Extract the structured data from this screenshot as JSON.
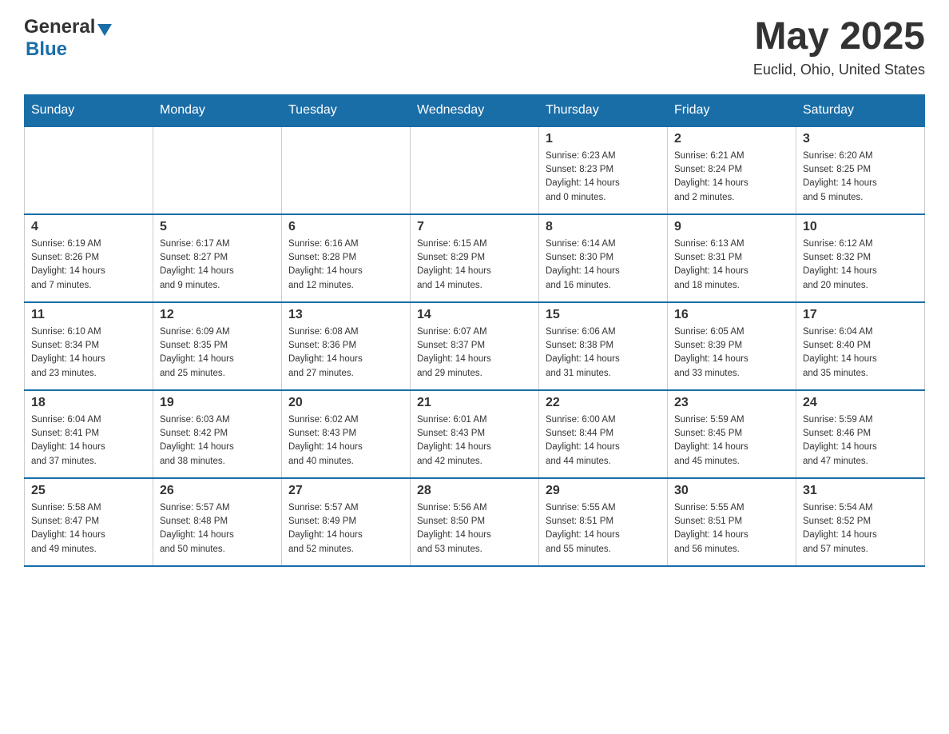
{
  "header": {
    "logo_general": "General",
    "logo_blue": "Blue",
    "title": "May 2025",
    "subtitle": "Euclid, Ohio, United States"
  },
  "weekdays": [
    "Sunday",
    "Monday",
    "Tuesday",
    "Wednesday",
    "Thursday",
    "Friday",
    "Saturday"
  ],
  "weeks": [
    [
      {
        "day": "",
        "info": ""
      },
      {
        "day": "",
        "info": ""
      },
      {
        "day": "",
        "info": ""
      },
      {
        "day": "",
        "info": ""
      },
      {
        "day": "1",
        "info": "Sunrise: 6:23 AM\nSunset: 8:23 PM\nDaylight: 14 hours\nand 0 minutes."
      },
      {
        "day": "2",
        "info": "Sunrise: 6:21 AM\nSunset: 8:24 PM\nDaylight: 14 hours\nand 2 minutes."
      },
      {
        "day": "3",
        "info": "Sunrise: 6:20 AM\nSunset: 8:25 PM\nDaylight: 14 hours\nand 5 minutes."
      }
    ],
    [
      {
        "day": "4",
        "info": "Sunrise: 6:19 AM\nSunset: 8:26 PM\nDaylight: 14 hours\nand 7 minutes."
      },
      {
        "day": "5",
        "info": "Sunrise: 6:17 AM\nSunset: 8:27 PM\nDaylight: 14 hours\nand 9 minutes."
      },
      {
        "day": "6",
        "info": "Sunrise: 6:16 AM\nSunset: 8:28 PM\nDaylight: 14 hours\nand 12 minutes."
      },
      {
        "day": "7",
        "info": "Sunrise: 6:15 AM\nSunset: 8:29 PM\nDaylight: 14 hours\nand 14 minutes."
      },
      {
        "day": "8",
        "info": "Sunrise: 6:14 AM\nSunset: 8:30 PM\nDaylight: 14 hours\nand 16 minutes."
      },
      {
        "day": "9",
        "info": "Sunrise: 6:13 AM\nSunset: 8:31 PM\nDaylight: 14 hours\nand 18 minutes."
      },
      {
        "day": "10",
        "info": "Sunrise: 6:12 AM\nSunset: 8:32 PM\nDaylight: 14 hours\nand 20 minutes."
      }
    ],
    [
      {
        "day": "11",
        "info": "Sunrise: 6:10 AM\nSunset: 8:34 PM\nDaylight: 14 hours\nand 23 minutes."
      },
      {
        "day": "12",
        "info": "Sunrise: 6:09 AM\nSunset: 8:35 PM\nDaylight: 14 hours\nand 25 minutes."
      },
      {
        "day": "13",
        "info": "Sunrise: 6:08 AM\nSunset: 8:36 PM\nDaylight: 14 hours\nand 27 minutes."
      },
      {
        "day": "14",
        "info": "Sunrise: 6:07 AM\nSunset: 8:37 PM\nDaylight: 14 hours\nand 29 minutes."
      },
      {
        "day": "15",
        "info": "Sunrise: 6:06 AM\nSunset: 8:38 PM\nDaylight: 14 hours\nand 31 minutes."
      },
      {
        "day": "16",
        "info": "Sunrise: 6:05 AM\nSunset: 8:39 PM\nDaylight: 14 hours\nand 33 minutes."
      },
      {
        "day": "17",
        "info": "Sunrise: 6:04 AM\nSunset: 8:40 PM\nDaylight: 14 hours\nand 35 minutes."
      }
    ],
    [
      {
        "day": "18",
        "info": "Sunrise: 6:04 AM\nSunset: 8:41 PM\nDaylight: 14 hours\nand 37 minutes."
      },
      {
        "day": "19",
        "info": "Sunrise: 6:03 AM\nSunset: 8:42 PM\nDaylight: 14 hours\nand 38 minutes."
      },
      {
        "day": "20",
        "info": "Sunrise: 6:02 AM\nSunset: 8:43 PM\nDaylight: 14 hours\nand 40 minutes."
      },
      {
        "day": "21",
        "info": "Sunrise: 6:01 AM\nSunset: 8:43 PM\nDaylight: 14 hours\nand 42 minutes."
      },
      {
        "day": "22",
        "info": "Sunrise: 6:00 AM\nSunset: 8:44 PM\nDaylight: 14 hours\nand 44 minutes."
      },
      {
        "day": "23",
        "info": "Sunrise: 5:59 AM\nSunset: 8:45 PM\nDaylight: 14 hours\nand 45 minutes."
      },
      {
        "day": "24",
        "info": "Sunrise: 5:59 AM\nSunset: 8:46 PM\nDaylight: 14 hours\nand 47 minutes."
      }
    ],
    [
      {
        "day": "25",
        "info": "Sunrise: 5:58 AM\nSunset: 8:47 PM\nDaylight: 14 hours\nand 49 minutes."
      },
      {
        "day": "26",
        "info": "Sunrise: 5:57 AM\nSunset: 8:48 PM\nDaylight: 14 hours\nand 50 minutes."
      },
      {
        "day": "27",
        "info": "Sunrise: 5:57 AM\nSunset: 8:49 PM\nDaylight: 14 hours\nand 52 minutes."
      },
      {
        "day": "28",
        "info": "Sunrise: 5:56 AM\nSunset: 8:50 PM\nDaylight: 14 hours\nand 53 minutes."
      },
      {
        "day": "29",
        "info": "Sunrise: 5:55 AM\nSunset: 8:51 PM\nDaylight: 14 hours\nand 55 minutes."
      },
      {
        "day": "30",
        "info": "Sunrise: 5:55 AM\nSunset: 8:51 PM\nDaylight: 14 hours\nand 56 minutes."
      },
      {
        "day": "31",
        "info": "Sunrise: 5:54 AM\nSunset: 8:52 PM\nDaylight: 14 hours\nand 57 minutes."
      }
    ]
  ]
}
